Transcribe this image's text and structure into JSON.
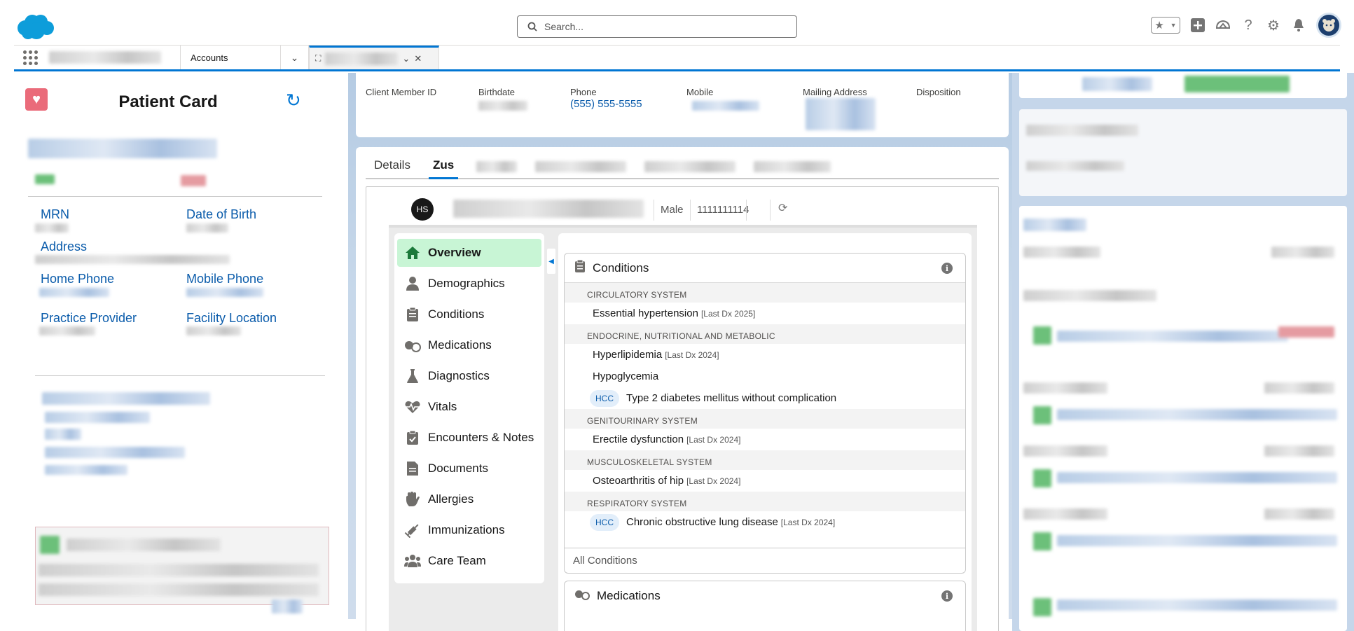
{
  "header": {
    "search_placeholder": "Search...",
    "icons": [
      "salesforce-cloud-icon",
      "search-icon",
      "star-icon",
      "add-icon",
      "trailhead-icon",
      "help-icon",
      "setup-gear-icon",
      "bell-icon",
      "user-avatar"
    ]
  },
  "nav": {
    "tab_accounts": "Accounts"
  },
  "patient_card": {
    "title": "Patient Card",
    "fields": {
      "mrn": "MRN",
      "dob": "Date of Birth",
      "address": "Address",
      "home_phone": "Home Phone",
      "mobile_phone": "Mobile Phone",
      "practice_provider": "Practice Provider",
      "facility_location": "Facility Location"
    }
  },
  "record": {
    "client_member_id_label": "Client Member ID",
    "birthdate_label": "Birthdate",
    "phone_label": "Phone",
    "phone_value": "(555) 555-5555",
    "mobile_label": "Mobile",
    "mailing_address_label": "Mailing Address",
    "disposition_label": "Disposition"
  },
  "tabs": [
    "Details",
    "Zus"
  ],
  "zus": {
    "initials": "HS",
    "gender": "Male",
    "id": "1111111114",
    "menu": [
      {
        "label": "Overview",
        "icon": "home-icon",
        "active": true
      },
      {
        "label": "Demographics",
        "icon": "person-icon"
      },
      {
        "label": "Conditions",
        "icon": "clipboard-icon"
      },
      {
        "label": "Medications",
        "icon": "pill-icon"
      },
      {
        "label": "Diagnostics",
        "icon": "flask-icon"
      },
      {
        "label": "Vitals",
        "icon": "heartbeat-icon"
      },
      {
        "label": "Encounters & Notes",
        "icon": "clipboard-check-icon"
      },
      {
        "label": "Documents",
        "icon": "document-icon"
      },
      {
        "label": "Allergies",
        "icon": "hand-icon"
      },
      {
        "label": "Immunizations",
        "icon": "syringe-icon"
      },
      {
        "label": "Care Team",
        "icon": "team-icon"
      }
    ],
    "conditions": {
      "title": "Conditions",
      "groups": [
        {
          "category": "CIRCULATORY SYSTEM",
          "items": [
            {
              "name": "Essential hypertension",
              "dx": "[Last Dx 2025]"
            }
          ]
        },
        {
          "category": "ENDOCRINE, NUTRITIONAL AND METABOLIC",
          "items": [
            {
              "name": "Hyperlipidemia",
              "dx": "[Last Dx 2024]"
            },
            {
              "name": "Hypoglycemia",
              "dx": ""
            },
            {
              "name": "Type 2 diabetes mellitus without complication",
              "dx": "",
              "hcc": "HCC"
            }
          ]
        },
        {
          "category": "GENITOURINARY SYSTEM",
          "items": [
            {
              "name": "Erectile dysfunction",
              "dx": "[Last Dx 2024]"
            }
          ]
        },
        {
          "category": "MUSCULOSKELETAL SYSTEM",
          "items": [
            {
              "name": "Osteoarthritis of hip",
              "dx": "[Last Dx 2024]"
            }
          ]
        },
        {
          "category": "RESPIRATORY SYSTEM",
          "items": [
            {
              "name": "Chronic obstructive lung disease",
              "dx": "[Last Dx 2024]",
              "hcc": "HCC"
            }
          ]
        }
      ],
      "footer": "All Conditions"
    },
    "medications_title": "Medications"
  },
  "colors": {
    "brand_blue": "#0176d3",
    "active_menu_bg": "#c8f5d5",
    "heart_red": "#ea6b7a"
  }
}
